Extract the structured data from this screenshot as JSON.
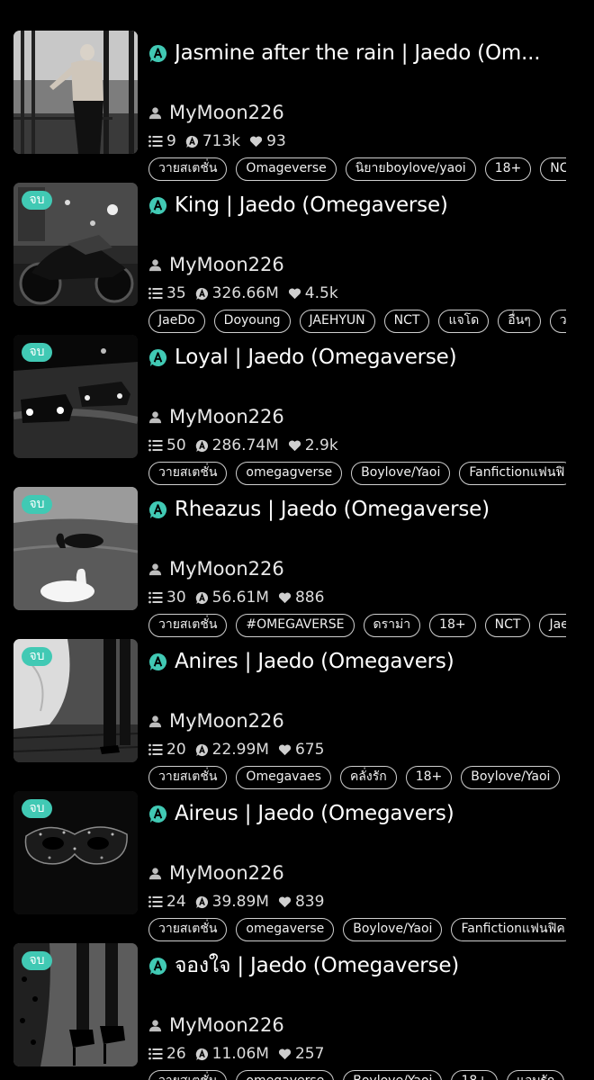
{
  "colors": {
    "background": "#000000",
    "accent": "#41c9b4",
    "tag_border": "#cfcfcf"
  },
  "icons": {
    "title": "a-badge-icon",
    "author": "person-icon",
    "chapters": "list-icon",
    "views": "a-circle-icon",
    "likes": "heart-icon"
  },
  "novels": [
    {
      "cover": "cover-man-balcony",
      "badge": "",
      "title": "Jasmine after the rain | Jaedo (Om...",
      "author": "MyMoon226",
      "chapters": "9",
      "views": "713k",
      "likes": "93",
      "tags": [
        "วายสเตชั่น",
        "Omageverse",
        "นิยายboylove/yaoi",
        "18+",
        "NCT"
      ]
    },
    {
      "cover": "cover-motorcycle",
      "badge": "จบ",
      "title": "King | Jaedo (Omegaverse)",
      "author": "MyMoon226",
      "chapters": "35",
      "views": "326.66M",
      "likes": "4.5k",
      "tags": [
        "JaeDo",
        "Doyoung",
        "JAEHYUN",
        "NCT",
        "แจโด",
        "อื่นๆ",
        "ว"
      ]
    },
    {
      "cover": "cover-cars-night",
      "badge": "จบ",
      "title": "Loyal | Jaedo (Omegaverse)",
      "author": "MyMoon226",
      "chapters": "50",
      "views": "286.74M",
      "likes": "2.9k",
      "tags": [
        "วายสเตชั่น",
        "omegagverse",
        "Boylove/Yaoi",
        "Fanfictionแฟนฟิ"
      ]
    },
    {
      "cover": "cover-swans",
      "badge": "จบ",
      "title": "Rheazus | Jaedo (Omegaverse)",
      "author": "MyMoon226",
      "chapters": "30",
      "views": "56.61M",
      "likes": "886",
      "tags": [
        "วายสเตชั่น",
        "#OMEGAVERSE",
        "ดราม่า",
        "18+",
        "NCT",
        "JaeD"
      ]
    },
    {
      "cover": "cover-dress-steps",
      "badge": "จบ",
      "title": "Anires | Jaedo (Omegavers)",
      "author": "MyMoon226",
      "chapters": "20",
      "views": "22.99M",
      "likes": "675",
      "tags": [
        "วายสเตชั่น",
        "Omegavaes",
        "คลั่งรัก",
        "18+",
        "Boylove/Yaoi",
        "("
      ]
    },
    {
      "cover": "cover-mask",
      "badge": "จบ",
      "title": "Aireus | Jaedo (Omegavers)",
      "author": "MyMoon226",
      "chapters": "24",
      "views": "39.89M",
      "likes": "839",
      "tags": [
        "วายสเตชั่น",
        "omegaverse",
        "Boylove/Yaoi",
        "Fanfictionแฟนฟิค"
      ]
    },
    {
      "cover": "cover-leopard-heels",
      "badge": "จบ",
      "title": "จองใจ | Jaedo (Omegaverse)",
      "author": "MyMoon226",
      "chapters": "26",
      "views": "11.06M",
      "likes": "257",
      "tags": [
        "วายสเตชั่น",
        "omegaverse",
        "Boylove/Yaoi",
        "18+",
        "แอบรัก",
        "("
      ]
    }
  ]
}
